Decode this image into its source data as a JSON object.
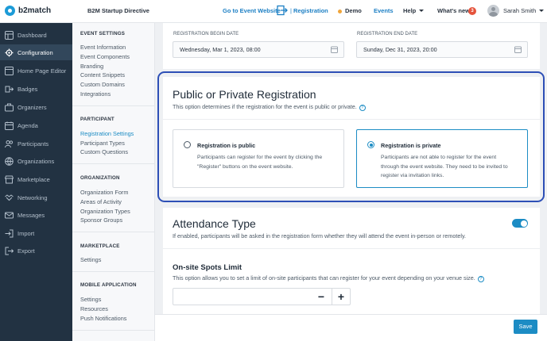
{
  "header": {
    "logo_text": "b2match",
    "event_title": "B2M Startup Directive",
    "goto_event": "Go to Event Website",
    "separator": "|",
    "registration": "Registration",
    "demo": "Demo",
    "events": "Events",
    "help": "Help",
    "whats_new": "What's new",
    "whats_new_count": "3",
    "user_name": "Sarah Smith"
  },
  "sidebar": {
    "items": [
      {
        "label": "Dashboard",
        "icon": "dashboard-icon"
      },
      {
        "label": "Configuration",
        "icon": "gear-icon",
        "active": true
      },
      {
        "label": "Home Page Editor",
        "icon": "home-icon"
      },
      {
        "label": "Badges",
        "icon": "badge-icon"
      },
      {
        "label": "Organizers",
        "icon": "briefcase-icon"
      },
      {
        "label": "Agenda",
        "icon": "calendar-icon"
      },
      {
        "label": "Participants",
        "icon": "users-icon"
      },
      {
        "label": "Organizations",
        "icon": "building-icon"
      },
      {
        "label": "Marketplace",
        "icon": "store-icon"
      },
      {
        "label": "Networking",
        "icon": "handshake-icon"
      },
      {
        "label": "Messages",
        "icon": "envelope-icon"
      },
      {
        "label": "Import",
        "icon": "import-icon"
      },
      {
        "label": "Export",
        "icon": "export-icon"
      }
    ]
  },
  "subnav": {
    "event_settings": {
      "title": "EVENT SETTINGS",
      "links": [
        "Event Information",
        "Event Components",
        "Branding",
        "Content Snippets",
        "Custom Domains",
        "Integrations"
      ]
    },
    "participant": {
      "title": "PARTICIPANT",
      "links": [
        "Registration Settings",
        "Participant Types",
        "Custom Questions"
      ]
    },
    "organization": {
      "title": "ORGANIZATION",
      "links": [
        "Organization Form",
        "Areas of Activity",
        "Organization Types",
        "Sponsor Groups"
      ]
    },
    "marketplace": {
      "title": "MARKETPLACE",
      "links": [
        "Settings"
      ]
    },
    "mobile": {
      "title": "MOBILE APPLICATION",
      "links": [
        "Settings",
        "Resources",
        "Push Notifications"
      ]
    }
  },
  "dates": {
    "begin_label": "REGISTRATION BEGIN DATE",
    "begin_value": "Wednesday, Mar 1, 2023, 08:00",
    "end_label": "REGISTRATION END DATE",
    "end_value": "Sunday, Dec 31, 2023, 20:00"
  },
  "registration_type": {
    "title": "Public or Private Registration",
    "description": "This option determines if the registration for the event is public or private.",
    "help_glyph": "?",
    "options": [
      {
        "title": "Registration is public",
        "description": "Participants can register for the event by clicking the \"Register\" buttons on the event website.",
        "selected": false
      },
      {
        "title": "Registration is private",
        "description": "Participants are not able to register for the event through the event website. They need to be invited to register via invitation links.",
        "selected": true
      }
    ]
  },
  "attendance": {
    "title": "Attendance Type",
    "description": "If enabled, participants will be asked in the registration form whether they will attend the event in-person or remotely.",
    "enabled": true
  },
  "onsite_limit": {
    "title": "On-site Spots Limit",
    "description": "This option allows you to set a limit of on-site participants that can register for your event depending on your venue size.",
    "help_glyph": "?",
    "minus": "−",
    "plus": "+"
  },
  "footer": {
    "save_label": "Save"
  },
  "colors": {
    "accent": "#1c8cc4",
    "sidebar_bg": "#223242",
    "focus_ring": "#2d4fb6"
  }
}
